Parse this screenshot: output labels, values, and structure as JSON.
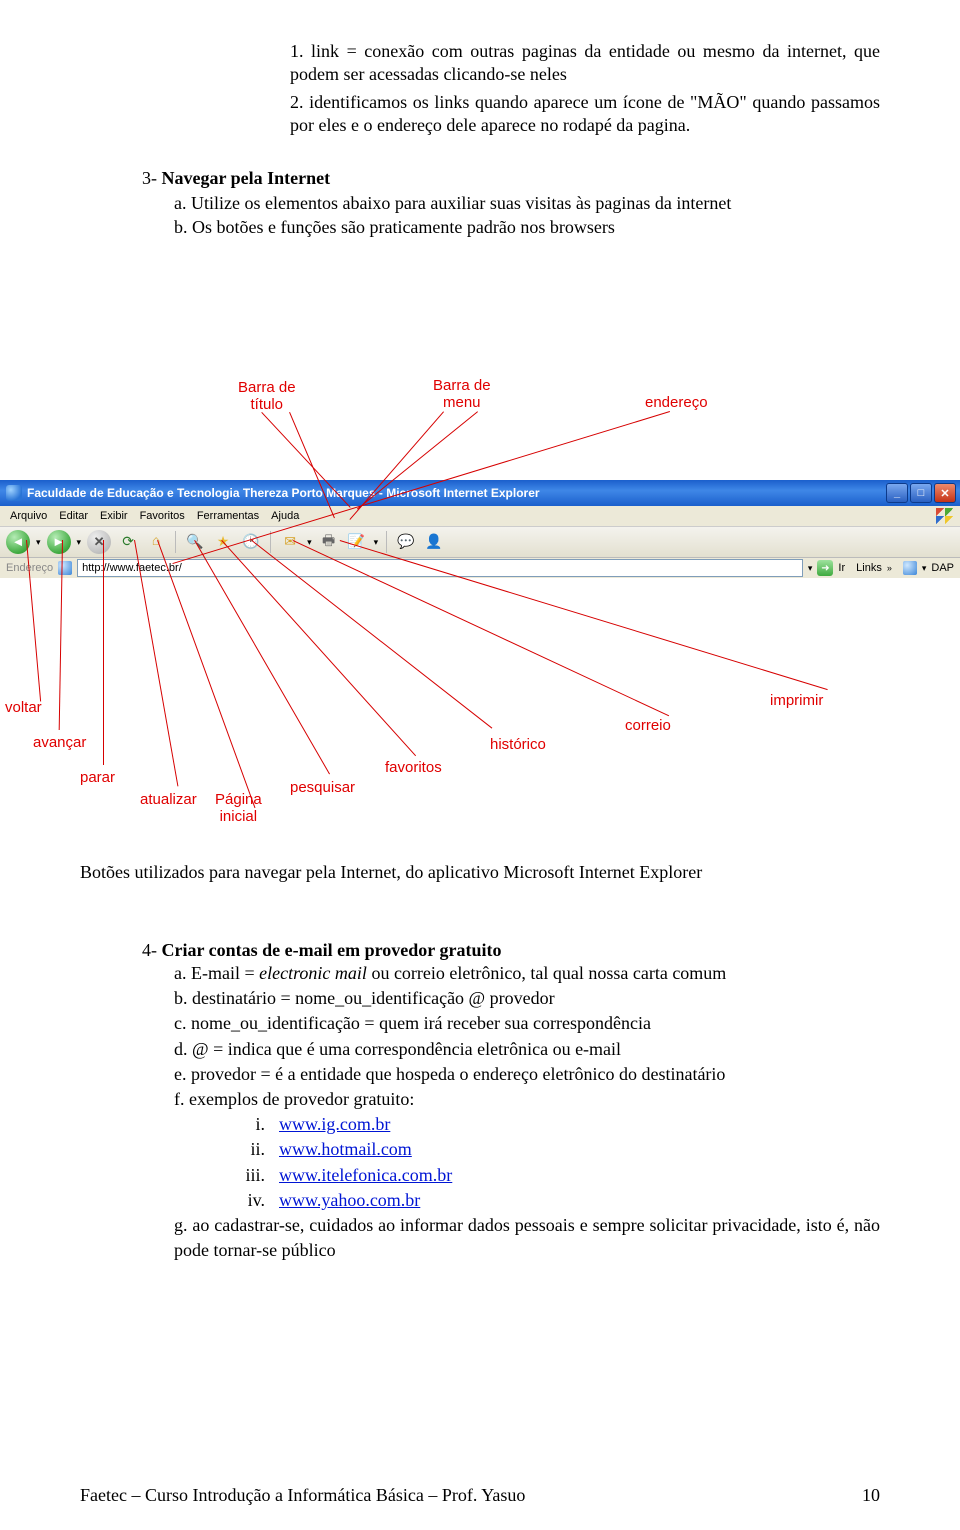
{
  "list1": {
    "i1": {
      "num": "1.",
      "text": "link = conexão com outras paginas da entidade ou mesmo da internet, que podem ser acessadas clicando-se neles"
    },
    "i2": {
      "num": "2.",
      "text": "identificamos os links quando aparece um ícone de \"MÃO\" quando passamos por eles e o endereço dele aparece no rodapé da pagina."
    }
  },
  "sec3": {
    "num": "3-",
    "title": "Navegar pela Internet",
    "a": "a.  Utilize os elementos abaixo para auxiliar suas visitas às paginas da internet",
    "b": "b.  Os botões e funções são praticamente padrão nos browsers"
  },
  "labels": {
    "barra_titulo1": "Barra de",
    "barra_titulo2": "título",
    "barra_menu1": "Barra de",
    "barra_menu2": "menu",
    "endereco": "endereço",
    "voltar": "voltar",
    "avancar": "avançar",
    "parar": "parar",
    "atualizar": "atualizar",
    "pagina1": "Página",
    "pagina2": "inicial",
    "pesquisar": "pesquisar",
    "favoritos": "favoritos",
    "historico": "histórico",
    "correio": "correio",
    "imprimir": "imprimir"
  },
  "browser": {
    "title": "Faculdade de Educação e Tecnologia Thereza Porto Marques - Microsoft Internet Explorer",
    "menu": {
      "arquivo": "Arquivo",
      "editar": "Editar",
      "exibir": "Exibir",
      "favoritos": "Favoritos",
      "ferramentas": "Ferramentas",
      "ajuda": "Ajuda"
    },
    "addr_label": "Endereço",
    "url": "http://www.faetec.br/",
    "go": "Ir",
    "links": "Links",
    "dap": "DAP"
  },
  "caption": "Botões utilizados para navegar pela Internet, do aplicativo Microsoft Internet Explorer",
  "sec4": {
    "num": "4-",
    "title": "Criar contas de e-mail em provedor gratuito",
    "a_pre": "a.  E-mail = ",
    "a_it": "electronic mail",
    "a_post": " ou correio eletrônico, tal qual nossa carta comum",
    "b": "b.  destinatário = nome_ou_identificação @ provedor",
    "c": "c.  nome_ou_identificação = quem irá receber sua correspondência",
    "d": "d.  @ = indica que é uma correspondência eletrônica ou e-mail",
    "e": "e.  provedor = é a entidade que hospeda o endereço eletrônico do destinatário",
    "f": "f.  exemplos de provedor gratuito:",
    "r1n": "i.",
    "r1": "www.ig.com.br",
    "r2n": "ii.",
    "r2": "www.hotmail.com",
    "r3n": "iii.",
    "r3": "www.itelefonica.com.br",
    "r4n": "iv.",
    "r4": "www.yahoo.com.br",
    "g": "g.  ao cadastrar-se, cuidados ao informar dados pessoais e sempre solicitar privacidade, isto é, não pode tornar-se público"
  },
  "footer": {
    "left": "Faetec – Curso Introdução a Informática Básica – Prof. Yasuo",
    "right": "10"
  }
}
